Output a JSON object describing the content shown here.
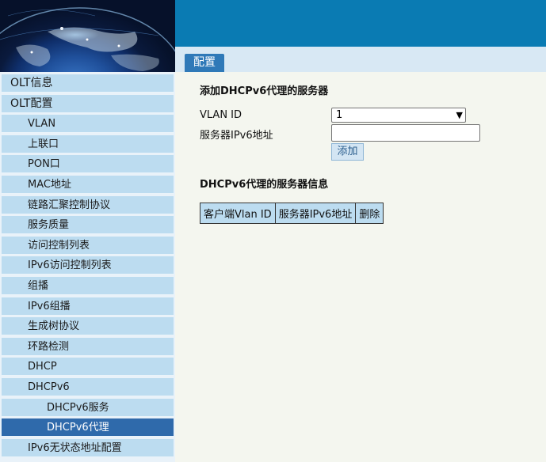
{
  "header": {
    "tab_label": "配置"
  },
  "sidebar": {
    "items": [
      {
        "label": "OLT信息",
        "level": 0,
        "active": false
      },
      {
        "label": "OLT配置",
        "level": 0,
        "active": false
      },
      {
        "label": "VLAN",
        "level": 1,
        "active": false
      },
      {
        "label": "上联口",
        "level": 1,
        "active": false
      },
      {
        "label": "PON口",
        "level": 1,
        "active": false
      },
      {
        "label": "MAC地址",
        "level": 1,
        "active": false
      },
      {
        "label": "链路汇聚控制协议",
        "level": 1,
        "active": false
      },
      {
        "label": "服务质量",
        "level": 1,
        "active": false
      },
      {
        "label": "访问控制列表",
        "level": 1,
        "active": false
      },
      {
        "label": "IPv6访问控制列表",
        "level": 1,
        "active": false
      },
      {
        "label": "组播",
        "level": 1,
        "active": false
      },
      {
        "label": "IPv6组播",
        "level": 1,
        "active": false
      },
      {
        "label": "生成树协议",
        "level": 1,
        "active": false
      },
      {
        "label": "环路检测",
        "level": 1,
        "active": false
      },
      {
        "label": "DHCP",
        "level": 1,
        "active": false
      },
      {
        "label": "DHCPv6",
        "level": 1,
        "active": false
      },
      {
        "label": "DHCPv6服务",
        "level": 2,
        "active": false
      },
      {
        "label": "DHCPv6代理",
        "level": 2,
        "active": true
      },
      {
        "label": "IPv6无状态地址配置",
        "level": 1,
        "active": false
      }
    ]
  },
  "form": {
    "title": "添加DHCPv6代理的服务器",
    "vlan_label": "VLAN ID",
    "vlan_value": "1",
    "server_label": "服务器IPv6地址",
    "server_value": "",
    "add_button": "添加"
  },
  "table": {
    "title": "DHCPv6代理的服务器信息",
    "headers": [
      "客户端Vlan ID",
      "服务器IPv6地址",
      "删除"
    ]
  },
  "colors": {
    "topbar": "#0a7bb3",
    "sidebar_item": "#bcdcf0",
    "sidebar_active": "#2f6aab",
    "tab": "#2f79b8"
  }
}
